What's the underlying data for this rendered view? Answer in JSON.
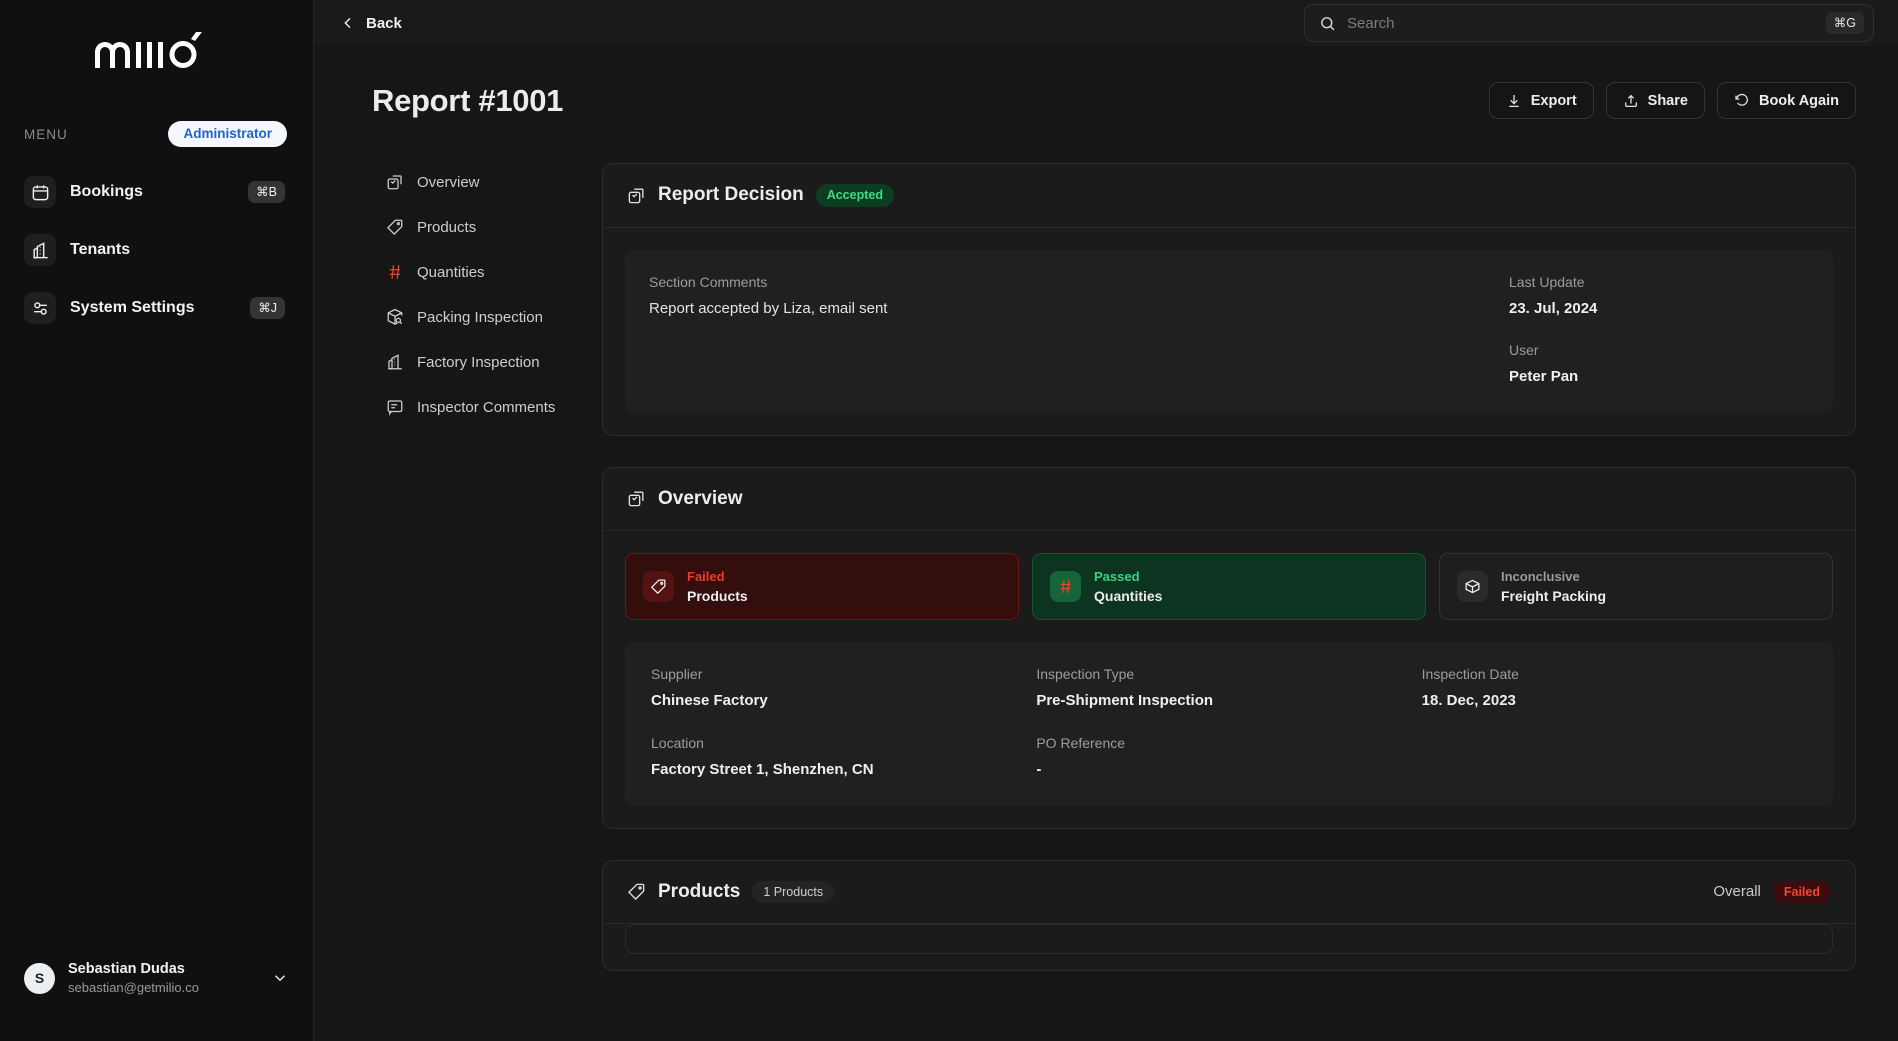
{
  "sidebar": {
    "logo_alt": "milio",
    "menu_label": "MENU",
    "role_pill": "Administrator",
    "items": [
      {
        "label": "Bookings",
        "icon": "calendar-icon",
        "kbd": "⌘B"
      },
      {
        "label": "Tenants",
        "icon": "building-icon",
        "kbd": ""
      },
      {
        "label": "System Settings",
        "icon": "sliders-icon",
        "kbd": "⌘J"
      }
    ],
    "user": {
      "initial": "S",
      "name": "Sebastian Dudas",
      "email": "sebastian@getmilio.co"
    }
  },
  "topbar": {
    "back_label": "Back",
    "search_placeholder": "Search",
    "search_value": "",
    "search_kbd": "⌘G"
  },
  "page": {
    "title": "Report #1001",
    "actions": [
      {
        "label": "Export",
        "icon": "download-icon"
      },
      {
        "label": "Share",
        "icon": "share-icon"
      },
      {
        "label": "Book Again",
        "icon": "history-icon"
      }
    ]
  },
  "section_nav": [
    {
      "label": "Overview",
      "icon": "copy-check-icon",
      "accent": false
    },
    {
      "label": "Products",
      "icon": "tag-icon",
      "accent": false
    },
    {
      "label": "Quantities",
      "icon": "hash-icon",
      "accent": true
    },
    {
      "label": "Packing Inspection",
      "icon": "package-search-icon",
      "accent": false
    },
    {
      "label": "Factory Inspection",
      "icon": "building-icon",
      "accent": false
    },
    {
      "label": "Inspector Comments",
      "icon": "message-square-icon",
      "accent": false
    }
  ],
  "report_decision": {
    "title": "Report Decision",
    "badge": "Accepted",
    "comments_label": "Section Comments",
    "comments_value": "Report accepted by Liza, email sent",
    "last_update_label": "Last Update",
    "last_update_value": "23. Jul, 2024",
    "user_label": "User",
    "user_value": "Peter Pan"
  },
  "overview": {
    "title": "Overview",
    "status_cards": [
      {
        "status": "Failed",
        "label": "Products",
        "icon": "tag-icon",
        "tone": "fail"
      },
      {
        "status": "Passed",
        "label": "Quantities",
        "icon": "hash-icon",
        "tone": "pass"
      },
      {
        "status": "Inconclusive",
        "label": "Freight Packing",
        "icon": "package-icon",
        "tone": "inconc"
      }
    ],
    "details": [
      {
        "label": "Supplier",
        "value": "Chinese Factory"
      },
      {
        "label": "Inspection Type",
        "value": "Pre-Shipment Inspection"
      },
      {
        "label": "Inspection Date",
        "value": "18. Dec, 2023"
      },
      {
        "label": "Location",
        "value": "Factory Street 1, Shenzhen, CN"
      },
      {
        "label": "PO Reference",
        "value": "-"
      },
      {
        "label": "",
        "value": ""
      }
    ]
  },
  "products": {
    "title": "Products",
    "count_badge": "1 Products",
    "overall_label": "Overall",
    "overall_badge": "Failed"
  },
  "colors": {
    "accent_red": "#e8452c",
    "pass_green": "#35d67e",
    "role_blue": "#2563c7",
    "sidebar_bg": "#101010",
    "main_bg": "#161616",
    "card_bg": "#1b1b1b"
  }
}
